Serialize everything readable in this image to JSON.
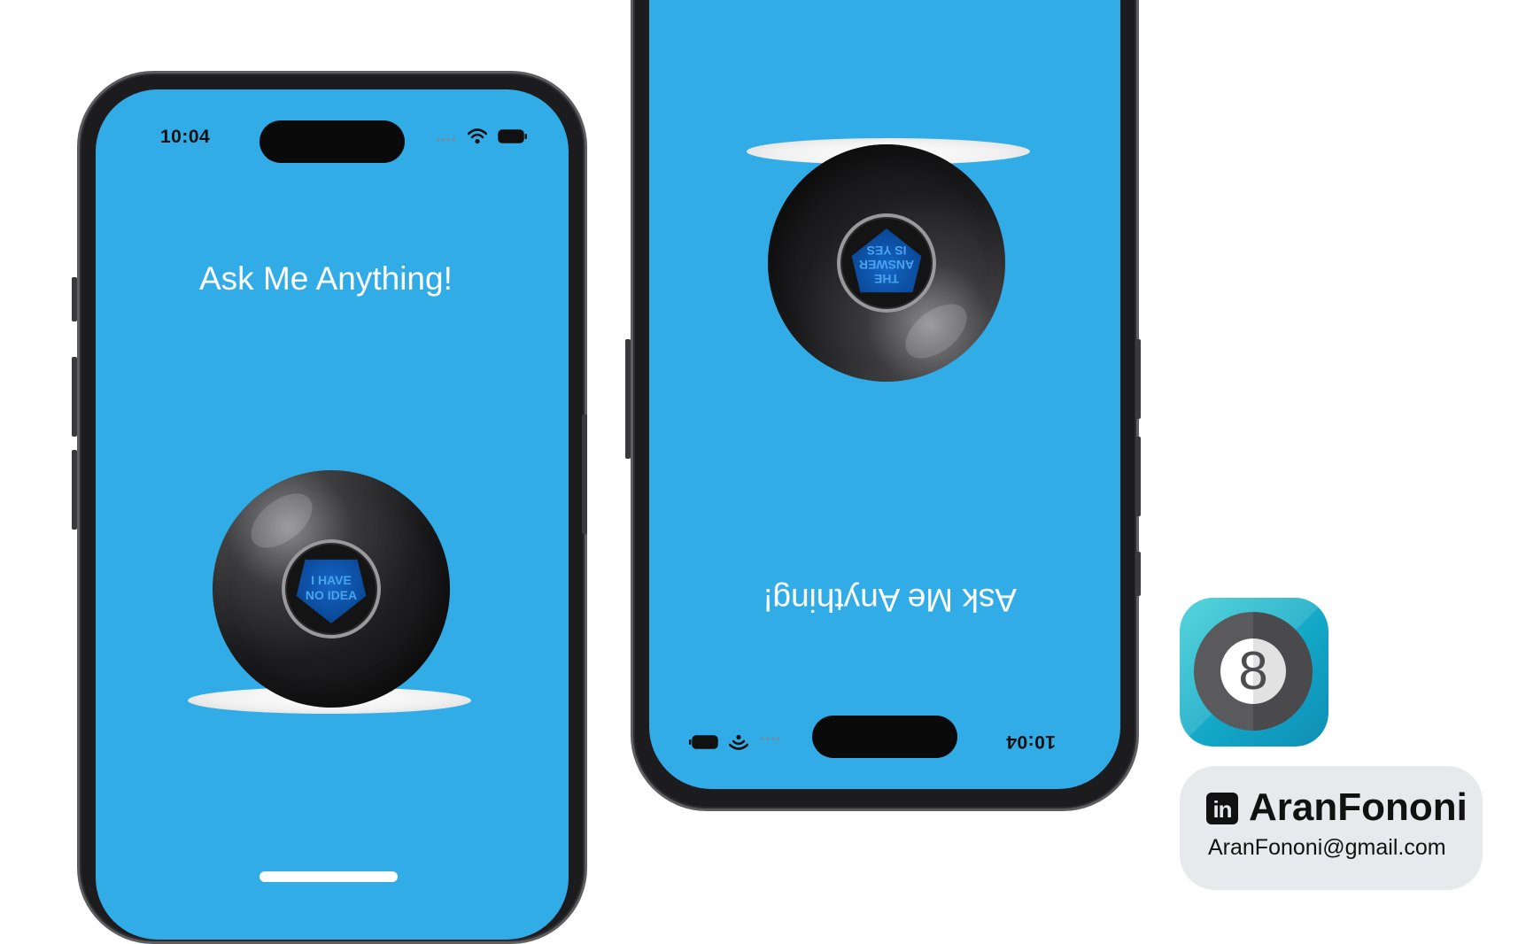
{
  "left_phone": {
    "status_time": "10:04",
    "signal_dots": "••••",
    "title": "Ask Me Anything!",
    "answer_lines": [
      "I HAVE",
      "NO IDEA"
    ]
  },
  "right_phone": {
    "status_time": "10:04",
    "signal_dots": "••••",
    "title": "Ask Me Anything!",
    "answer_lines": [
      "THE",
      "ANSWER",
      "IS YES"
    ],
    "rotation": "180deg"
  },
  "app_icon": {
    "glyph": "8"
  },
  "contact": {
    "linkedin_glyph": "in",
    "name": "AranFononi",
    "email": "AranFononi@gmail.com"
  },
  "colors": {
    "screen_background": "#32ace6",
    "answer_triangle": "#0a4796",
    "icon_gradient": "#12a7c6"
  }
}
